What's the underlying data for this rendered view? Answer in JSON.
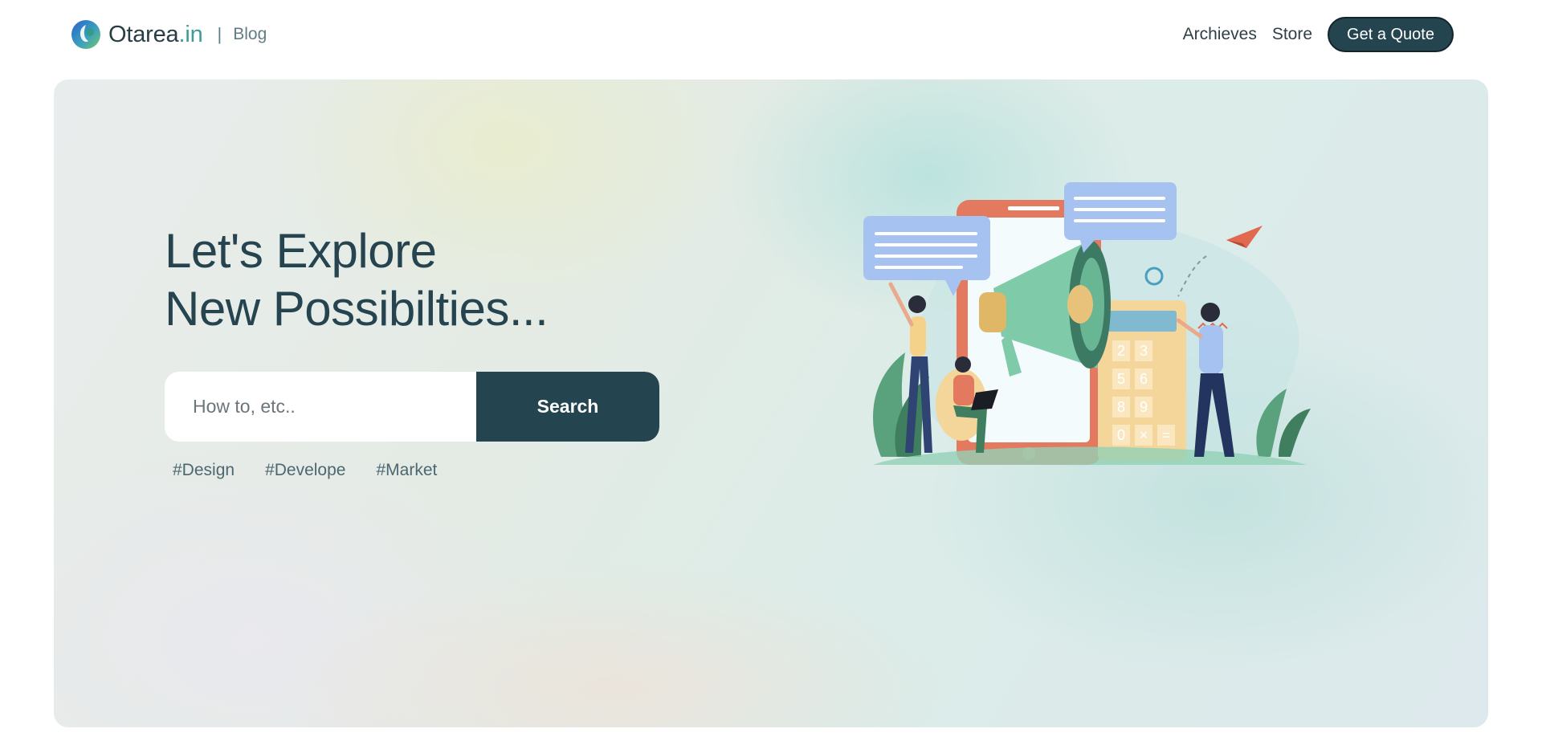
{
  "navbar": {
    "brand_name": "Otarea",
    "brand_tld": ".in",
    "separator": "|",
    "section": "Blog",
    "links": [
      "Archieves",
      "Store"
    ],
    "cta_label": "Get a Quote"
  },
  "hero": {
    "title_line1": "Let's Explore",
    "title_line2": "New Possibilties...",
    "search": {
      "placeholder": "How to, etc..",
      "value": "",
      "button_label": "Search"
    },
    "tags": [
      "#Design",
      "#Develope",
      "#Market"
    ]
  },
  "illustration": {
    "calculator_keys": [
      "2",
      "3",
      "5",
      "6",
      "8",
      "9",
      "0",
      "×",
      "="
    ],
    "icons": [
      "megaphone-illustration",
      "phone-illustration",
      "calculator-illustration",
      "paper-plane-icon",
      "speech-bubble-icon"
    ]
  },
  "colors": {
    "primary": "#24444f",
    "accent": "#3e9d97",
    "text_muted": "#607d86"
  }
}
